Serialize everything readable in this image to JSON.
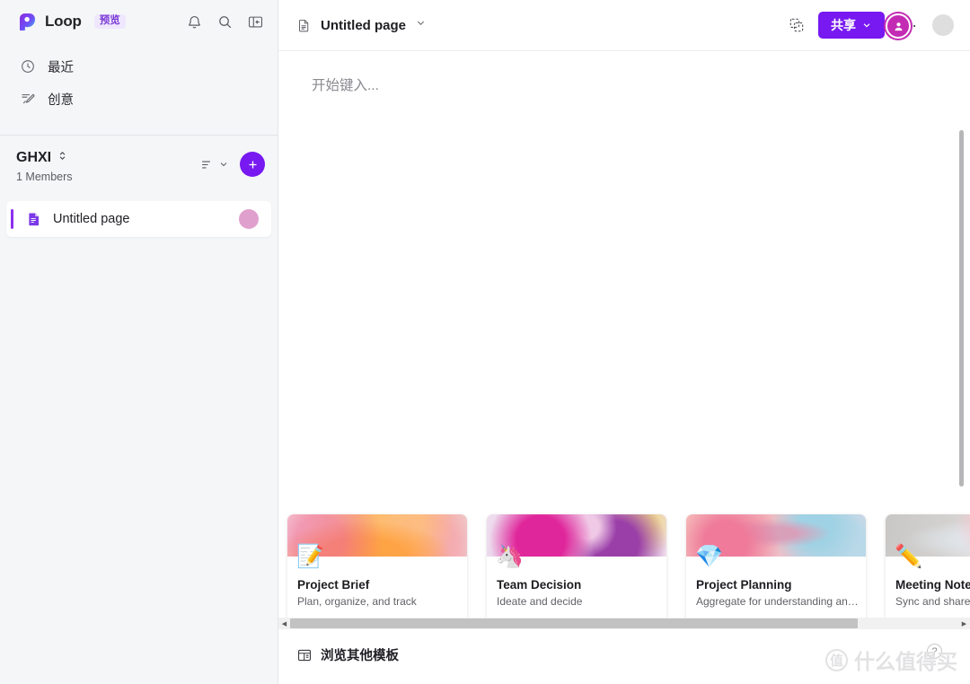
{
  "sidebar": {
    "brand": {
      "name": "Loop",
      "badge": "预览",
      "logo_icon": "loop-logo-icon"
    },
    "top_icons": [
      {
        "name": "notifications-icon",
        "label": ""
      },
      {
        "name": "search-icon",
        "label": ""
      },
      {
        "name": "collapse-panel-icon",
        "label": ""
      }
    ],
    "nav": [
      {
        "label": "最近",
        "icon": "clock-icon"
      },
      {
        "label": "创意",
        "icon": "idea-pen-icon"
      }
    ],
    "workspace": {
      "title": "GHXI",
      "members": "1 Members",
      "sort_icon": "sort-lines-icon",
      "add_label": "+"
    },
    "pages": [
      {
        "label": "Untitled page",
        "icon": "document-icon",
        "selected": true
      }
    ]
  },
  "topbar": {
    "page_title": "Untitled page",
    "page_icon": "document-icon",
    "copy_icon": "duplicate-icon",
    "share_label": "共享",
    "more_label": "···",
    "avatar_icon": "person-icon"
  },
  "editor": {
    "placeholder": "开始键入..."
  },
  "templates": [
    {
      "title": "Project Brief",
      "desc": "Plan, organize, and track",
      "emoji": "📝",
      "art": "art-brief"
    },
    {
      "title": "Team Decision",
      "desc": "Ideate and decide",
      "emoji": "🦄",
      "art": "art-team"
    },
    {
      "title": "Project Planning",
      "desc": "Aggregate for understanding an…",
      "emoji": "💎",
      "art": "art-planning"
    },
    {
      "title": "Meeting Notes",
      "desc": "Sync and share",
      "emoji": "✏️",
      "art": "art-meeting"
    }
  ],
  "bottom": {
    "browse_label": "浏览其他模板",
    "browse_icon": "template-grid-icon",
    "help_label": "?"
  },
  "watermark": {
    "mark": "值",
    "text": "什么值得买"
  },
  "colors": {
    "accent_purple": "#7719f0",
    "badge_purple": "#7a3ad6",
    "page_avatar_pink": "#e0a0ce",
    "center_avatar_magenta": "#c32bb4",
    "sidebar_bg": "#f5f6f8"
  }
}
